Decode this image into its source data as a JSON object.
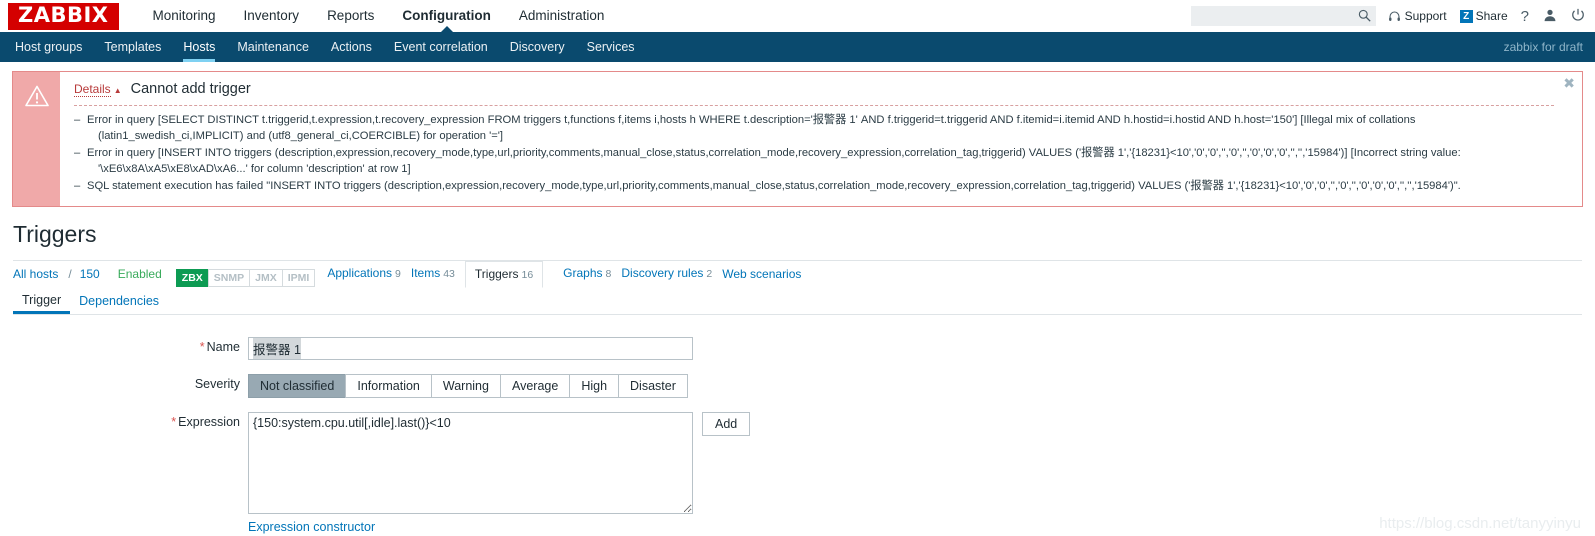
{
  "header": {
    "logo": "ZABBIX",
    "menu": [
      {
        "label": "Monitoring",
        "selected": false
      },
      {
        "label": "Inventory",
        "selected": false
      },
      {
        "label": "Reports",
        "selected": false
      },
      {
        "label": "Configuration",
        "selected": true
      },
      {
        "label": "Administration",
        "selected": false
      }
    ],
    "search_placeholder": "",
    "search_value": "",
    "support_label": "Support",
    "share_label": "Share",
    "share_badge": "Z",
    "help_label": "?",
    "icons": [
      "search-icon",
      "headset-icon",
      "share-icon",
      "question-icon",
      "user-icon",
      "power-icon"
    ]
  },
  "subnav": {
    "items": [
      {
        "label": "Host groups",
        "selected": false
      },
      {
        "label": "Templates",
        "selected": false
      },
      {
        "label": "Hosts",
        "selected": true
      },
      {
        "label": "Maintenance",
        "selected": false
      },
      {
        "label": "Actions",
        "selected": false
      },
      {
        "label": "Event correlation",
        "selected": false
      },
      {
        "label": "Discovery",
        "selected": false
      },
      {
        "label": "Services",
        "selected": false
      }
    ],
    "draft_label": "zabbix for draft"
  },
  "message": {
    "details_label": "Details",
    "details_arrow": "▲",
    "title": "Cannot add trigger",
    "close_label": "✖",
    "lines": [
      {
        "main": "Error in query [SELECT DISTINCT t.triggerid,t.expression,t.recovery_expression FROM triggers t,functions f,items i,hosts h WHERE t.description='报警器 1' AND f.triggerid=t.triggerid AND f.itemid=i.itemid AND h.hostid=i.hostid AND h.host='150'] [Illegal mix of collations",
        "cont": "(latin1_swedish_ci,IMPLICIT) and (utf8_general_ci,COERCIBLE) for operation '=']"
      },
      {
        "main": "Error in query [INSERT INTO triggers (description,expression,recovery_mode,type,url,priority,comments,manual_close,status,correlation_mode,recovery_expression,correlation_tag,triggerid) VALUES ('报警器 1','{18231}<10','0','0','','0','','0','0','0','','','15984')] [Incorrect string value:",
        "cont": "'\\xE6\\x8A\\xA5\\xE8\\xAD\\xA6...' for column 'description' at row 1]"
      },
      {
        "main": "SQL statement execution has failed \"INSERT INTO triggers (description,expression,recovery_mode,type,url,priority,comments,manual_close,status,correlation_mode,recovery_expression,correlation_tag,triggerid) VALUES ('报警器 1','{18231}<10','0','0','','0','','0','0','0','','','15984')\".",
        "cont": ""
      }
    ]
  },
  "page": {
    "title": "Triggers"
  },
  "breadcrumb": {
    "all_hosts": "All hosts",
    "separator": "/",
    "host": "150",
    "status": "Enabled",
    "tags": [
      {
        "label": "ZBX",
        "active": true
      },
      {
        "label": "SNMP",
        "active": false
      },
      {
        "label": "JMX",
        "active": false
      },
      {
        "label": "IPMI",
        "active": false
      }
    ],
    "links": [
      {
        "label": "Applications",
        "count": "9",
        "active": false
      },
      {
        "label": "Items",
        "count": "43",
        "active": false
      },
      {
        "label": "Triggers",
        "count": "16",
        "active": true
      },
      {
        "label": "Graphs",
        "count": "8",
        "active": false
      },
      {
        "label": "Discovery rules",
        "count": "2",
        "active": false
      },
      {
        "label": "Web scenarios",
        "count": "",
        "active": false
      }
    ]
  },
  "form_tabs": [
    {
      "label": "Trigger",
      "active": true
    },
    {
      "label": "Dependencies",
      "active": false
    }
  ],
  "form": {
    "name_label": "Name",
    "name_value": "报警器 1",
    "name_required": "*",
    "severity_label": "Severity",
    "severity_options": [
      {
        "label": "Not classified",
        "selected": true
      },
      {
        "label": "Information",
        "selected": false
      },
      {
        "label": "Warning",
        "selected": false
      },
      {
        "label": "Average",
        "selected": false
      },
      {
        "label": "High",
        "selected": false
      },
      {
        "label": "Disaster",
        "selected": false
      }
    ],
    "expression_label": "Expression",
    "expression_required": "*",
    "expression_value": "{150:system.cpu.util[,idle].last()}<10",
    "add_button": "Add",
    "constructor_link": "Expression constructor"
  },
  "watermark": "https://blog.csdn.net/tanyyinyu",
  "colors": {
    "brand_red": "#d40000",
    "nav_dark_blue": "#0a4a6e",
    "link_blue": "#0275b8",
    "error_border": "#e48a8a",
    "error_icon_bg": "#f0a9a9",
    "zbx_green": "#0d9b53",
    "required_red": "#d9534f"
  }
}
